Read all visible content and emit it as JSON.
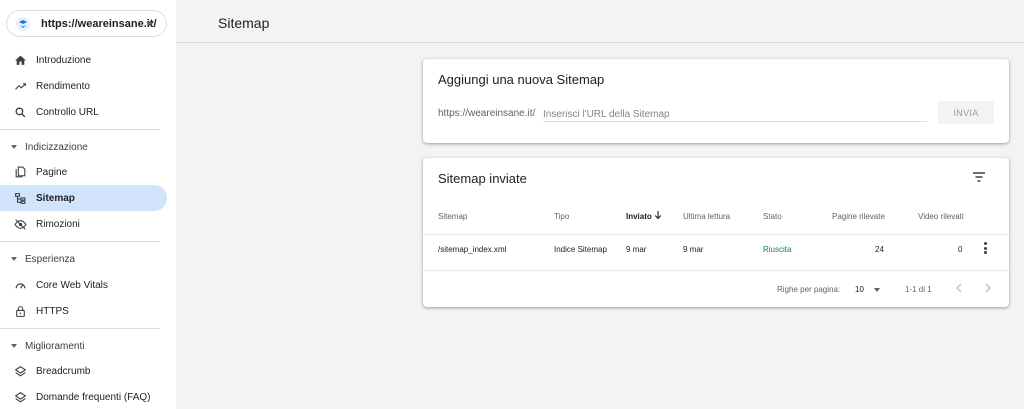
{
  "property": {
    "url": "https://weareinsane.it/"
  },
  "nav": {
    "top": [
      {
        "label": "Introduzione",
        "icon": "home-icon"
      },
      {
        "label": "Rendimento",
        "icon": "trending-up-icon"
      },
      {
        "label": "Controllo URL",
        "icon": "search-icon"
      }
    ],
    "sections": [
      {
        "title": "Indicizzazione",
        "items": [
          {
            "label": "Pagine",
            "icon": "pages-icon"
          },
          {
            "label": "Sitemap",
            "icon": "sitemap-icon",
            "active": true
          },
          {
            "label": "Rimozioni",
            "icon": "eye-off-icon"
          }
        ]
      },
      {
        "title": "Esperienza",
        "items": [
          {
            "label": "Core Web Vitals",
            "icon": "speedometer-icon"
          },
          {
            "label": "HTTPS",
            "icon": "lock-icon"
          }
        ]
      },
      {
        "title": "Miglioramenti",
        "items": [
          {
            "label": "Breadcrumb",
            "icon": "layers-icon"
          },
          {
            "label": "Domande frequenti (FAQ)",
            "icon": "layers-icon"
          }
        ]
      }
    ]
  },
  "header": {
    "title": "Sitemap"
  },
  "add_card": {
    "title": "Aggiungi una nuova Sitemap",
    "prefix": "https://weareinsane.it/",
    "placeholder": "Inserisci l'URL della Sitemap",
    "submit_label": "INVIA"
  },
  "list_card": {
    "title": "Sitemap inviate",
    "columns": [
      "Sitemap",
      "Tipo",
      "Inviato",
      "Ultima lettura",
      "Stato",
      "Pagine rilevate",
      "Video rilevati"
    ],
    "rows": [
      [
        "/sitemap_index.xml",
        "Indice Sitemap",
        "9 mar",
        "9 mar",
        "Riuscita",
        "24",
        "0"
      ]
    ],
    "pagination": {
      "rows_per_page_label": "Righe per pagina:",
      "rows_per_page": "10",
      "range": "1-1 di 1"
    }
  },
  "colors": {
    "accent": "#1a73e8",
    "active_bg": "#d2e3fc",
    "success": "#188038"
  }
}
